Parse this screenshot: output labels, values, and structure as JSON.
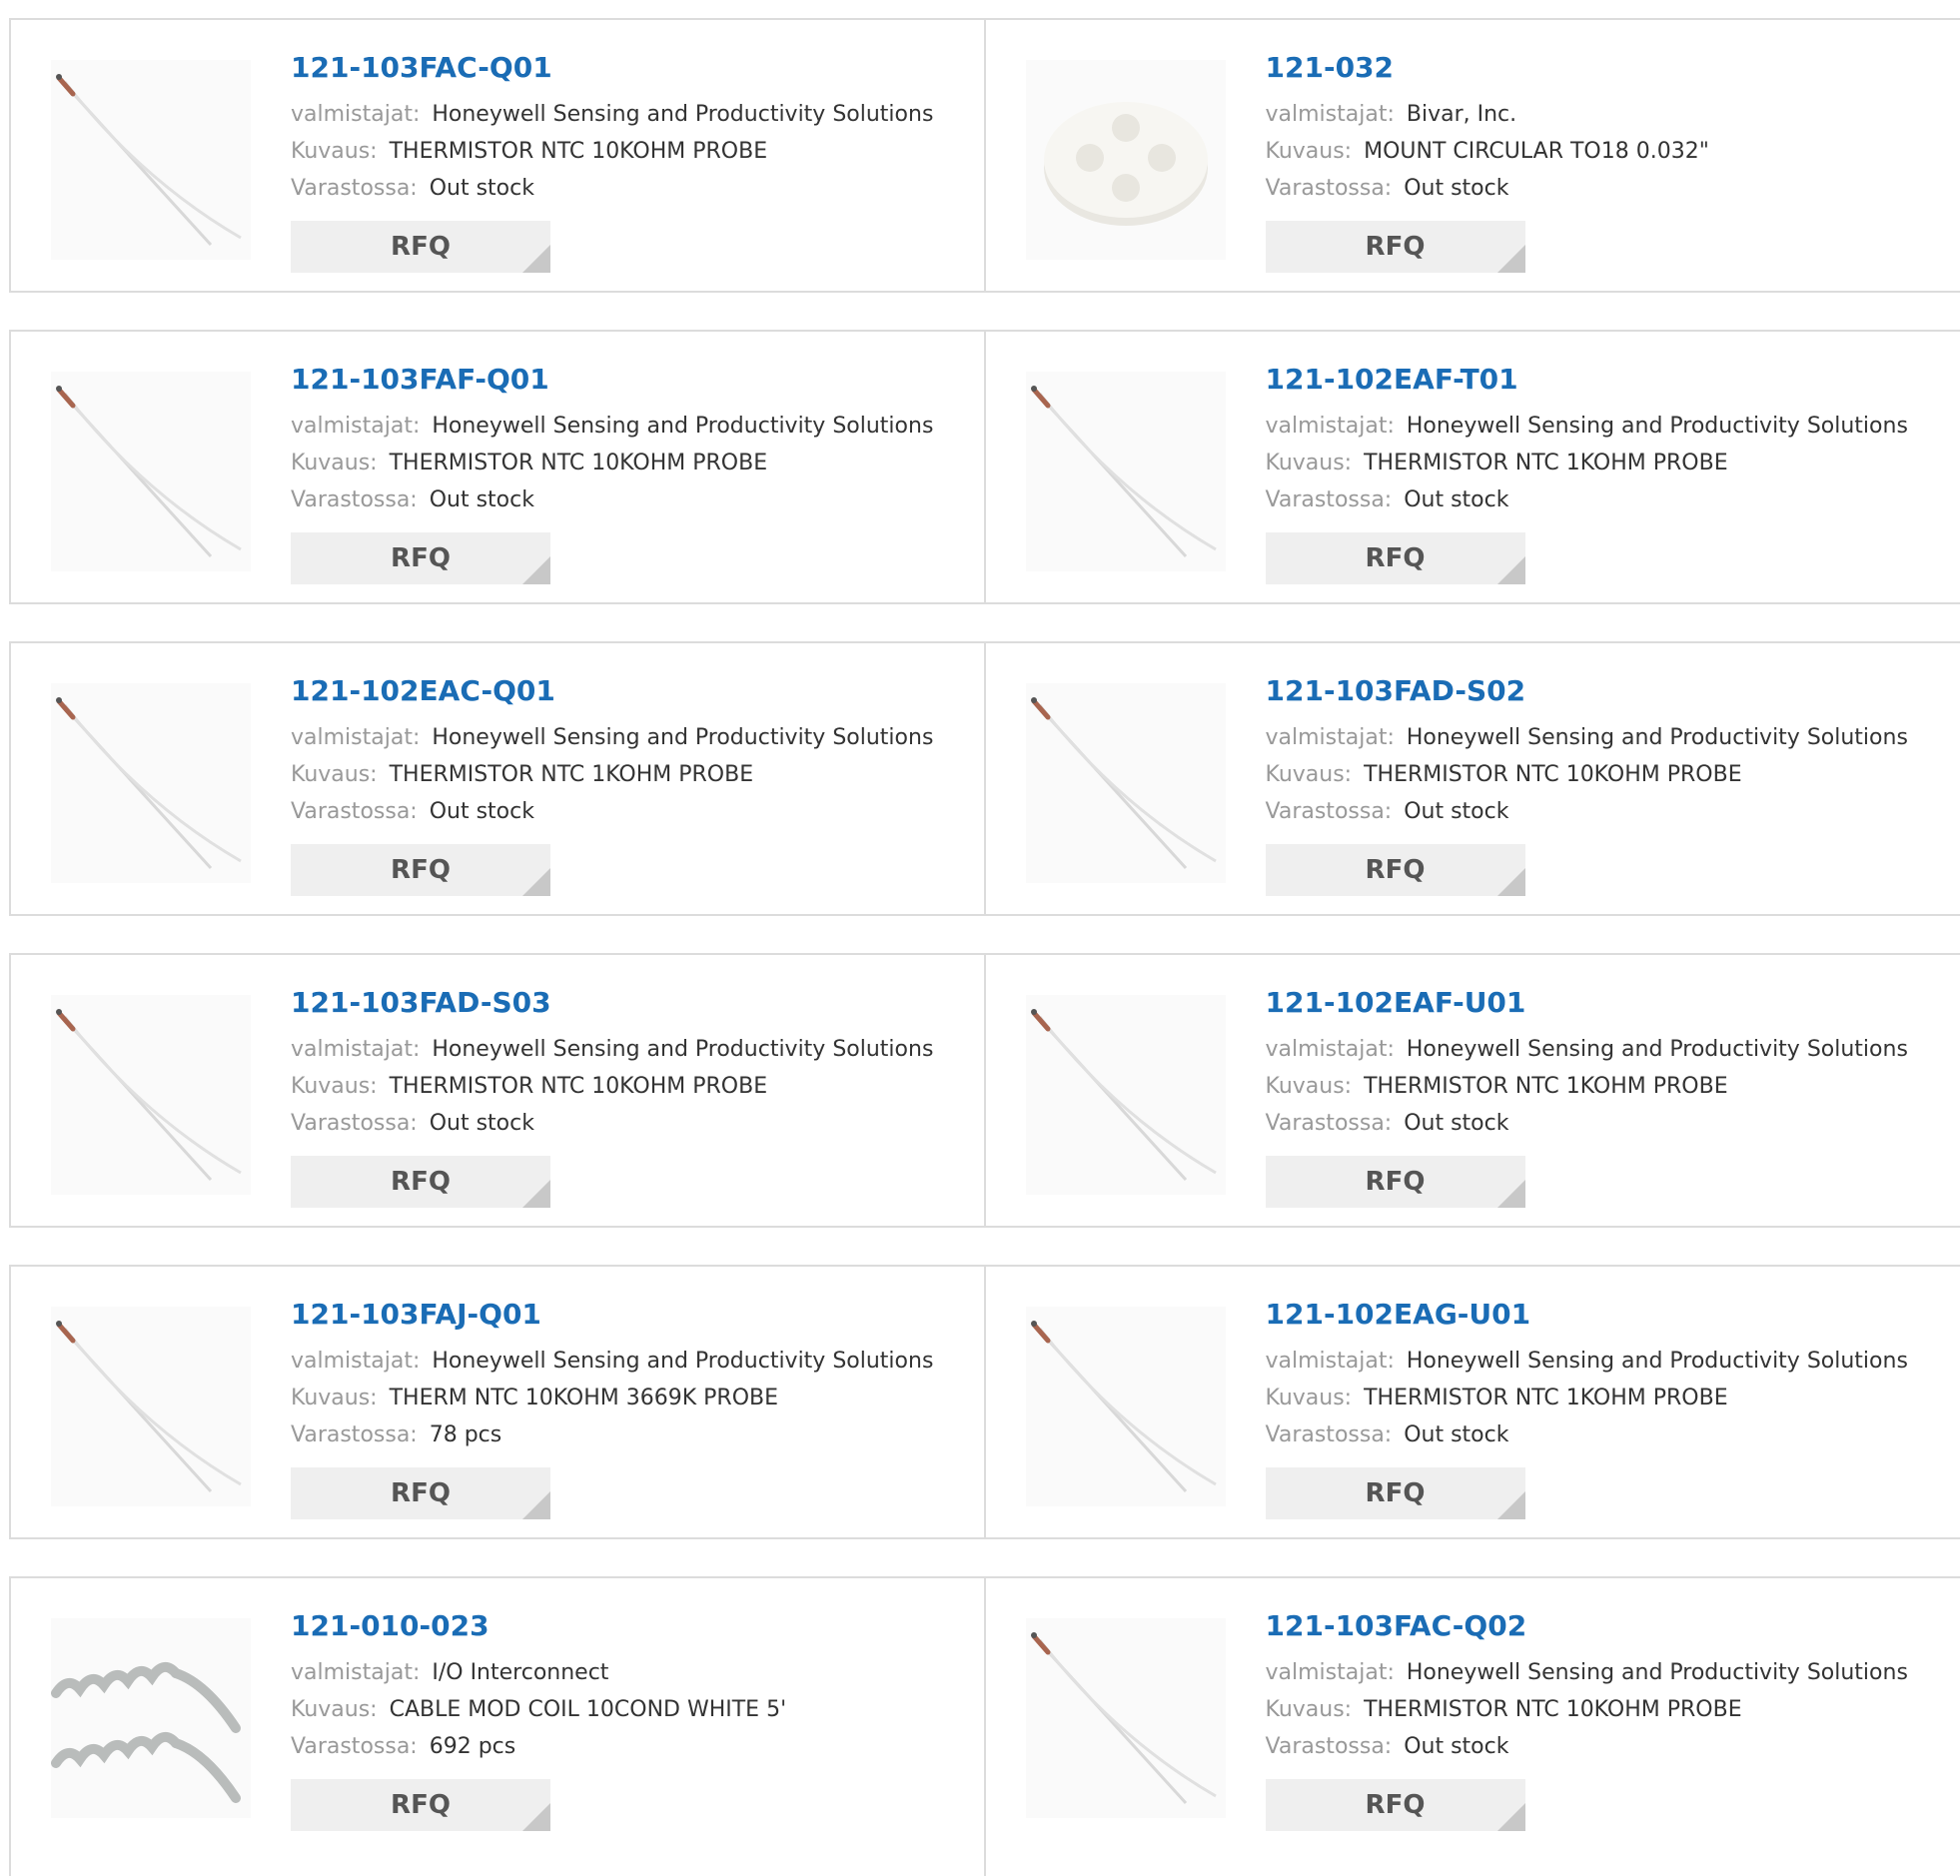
{
  "labels": {
    "manufacturer": "valmistajat:",
    "description": "Kuvaus:",
    "stock": "Varastossa:",
    "rfq": "RFQ"
  },
  "products": [
    {
      "part": "121-103FAC-Q01",
      "manufacturer": "Honeywell Sensing and Productivity Solutions",
      "description": "THERMISTOR NTC 10KOHM PROBE",
      "stock": "Out stock",
      "image": "thermistor-probe"
    },
    {
      "part": "121-032",
      "manufacturer": "Bivar, Inc.",
      "description": "MOUNT CIRCULAR TO18 0.032\"",
      "stock": "Out stock",
      "image": "circular-mount"
    },
    {
      "part": "121-103FAF-Q01",
      "manufacturer": "Honeywell Sensing and Productivity Solutions",
      "description": "THERMISTOR NTC 10KOHM PROBE",
      "stock": "Out stock",
      "image": "thermistor-probe"
    },
    {
      "part": "121-102EAF-T01",
      "manufacturer": "Honeywell Sensing and Productivity Solutions",
      "description": "THERMISTOR NTC 1KOHM PROBE",
      "stock": "Out stock",
      "image": "thermistor-probe"
    },
    {
      "part": "121-102EAC-Q01",
      "manufacturer": "Honeywell Sensing and Productivity Solutions",
      "description": "THERMISTOR NTC 1KOHM PROBE",
      "stock": "Out stock",
      "image": "thermistor-probe"
    },
    {
      "part": "121-103FAD-S02",
      "manufacturer": "Honeywell Sensing and Productivity Solutions",
      "description": "THERMISTOR NTC 10KOHM PROBE",
      "stock": "Out stock",
      "image": "thermistor-probe"
    },
    {
      "part": "121-103FAD-S03",
      "manufacturer": "Honeywell Sensing and Productivity Solutions",
      "description": "THERMISTOR NTC 10KOHM PROBE",
      "stock": "Out stock",
      "image": "thermistor-probe"
    },
    {
      "part": "121-102EAF-U01",
      "manufacturer": "Honeywell Sensing and Productivity Solutions",
      "description": "THERMISTOR NTC 1KOHM PROBE",
      "stock": "Out stock",
      "image": "thermistor-probe"
    },
    {
      "part": "121-103FAJ-Q01",
      "manufacturer": "Honeywell Sensing and Productivity Solutions",
      "description": "THERM NTC 10KOHM 3669K PROBE",
      "stock": "78 pcs",
      "image": "thermistor-probe"
    },
    {
      "part": "121-102EAG-U01",
      "manufacturer": "Honeywell Sensing and Productivity Solutions",
      "description": "THERMISTOR NTC 1KOHM PROBE",
      "stock": "Out stock",
      "image": "thermistor-probe"
    },
    {
      "part": "121-010-023",
      "manufacturer": "I/O Interconnect",
      "description": "CABLE MOD COIL 10COND WHITE 5'",
      "stock": "692 pcs",
      "image": "coiled-cable"
    },
    {
      "part": "121-103FAC-Q02",
      "manufacturer": "Honeywell Sensing and Productivity Solutions",
      "description": "THERMISTOR NTC 10KOHM PROBE",
      "stock": "Out stock",
      "image": "thermistor-probe"
    }
  ],
  "colors": {
    "part_link": "#1a6cb5",
    "label": "#999999",
    "value": "#333333",
    "rfq_bg": "#efefef",
    "rfq_corner": "#c8c8c8",
    "border": "#dcdcdc"
  }
}
